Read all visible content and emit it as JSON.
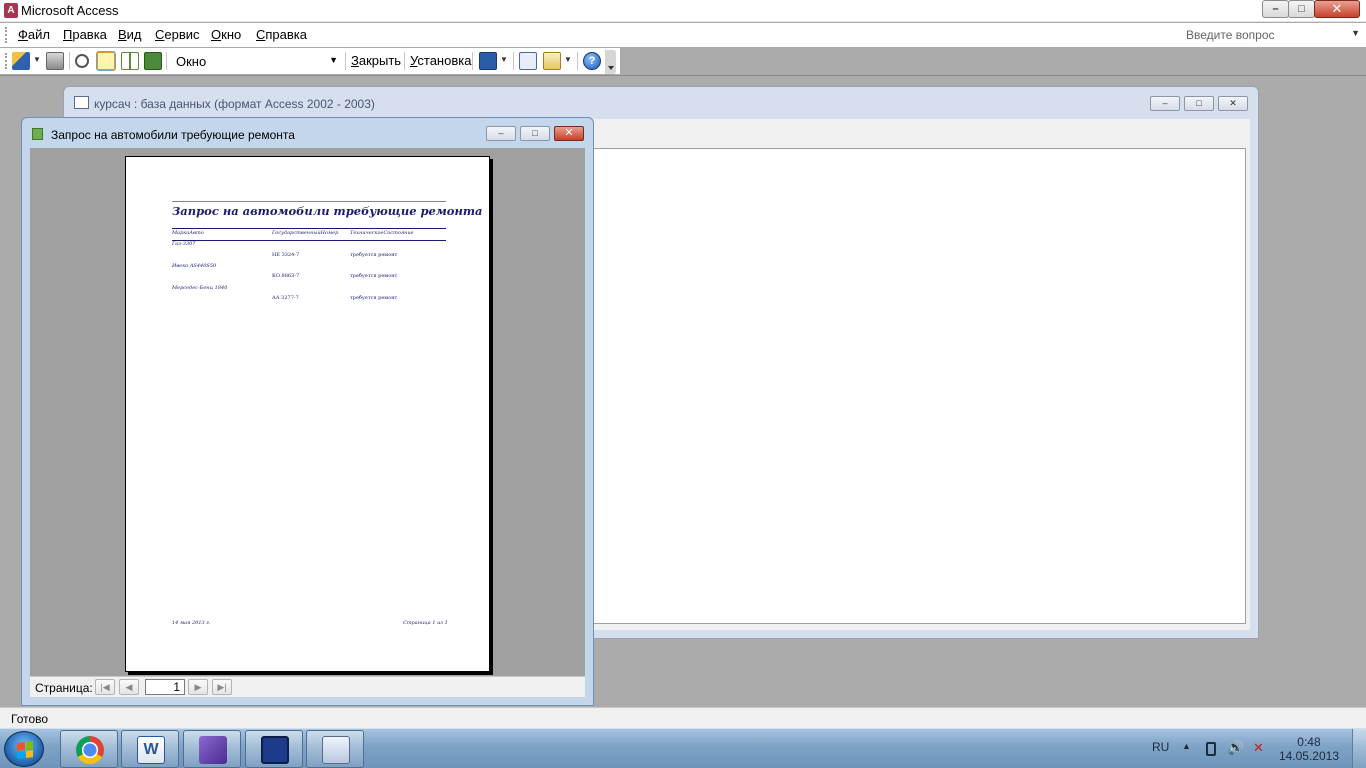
{
  "app": {
    "title": "Microsoft Access",
    "icon": "access-icon",
    "window_buttons": {
      "minimize": "–",
      "maximize": "□",
      "close": "✕"
    }
  },
  "menu": {
    "items": [
      "Файл",
      "Правка",
      "Вид",
      "Сервис",
      "Окно",
      "Справка"
    ],
    "help_placeholder": "Введите вопрос"
  },
  "toolbar": {
    "view_combo_value": "Окно",
    "close_label": "Закрыть",
    "setup_label": "Установка",
    "icons": [
      "design-view-icon",
      "print-icon",
      "zoom-icon",
      "one-page-icon",
      "two-pages-icon",
      "multiple-pages-icon",
      "office-links-icon",
      "database-window-icon",
      "new-object-icon",
      "help-icon"
    ]
  },
  "db_window": {
    "title": "курсач : база данных (формат Access 2002 - 2003)"
  },
  "report_window": {
    "title": "Запрос на автомобили требующие ремонта",
    "page_label": "Страница:",
    "page_number": "1"
  },
  "report": {
    "title": "Запрос на автомобили требующие ремонта",
    "columns": [
      "МаркаАвто",
      "ГосударственныйНомер",
      "ТехническоеСостояние"
    ],
    "rows": [
      {
        "make": "Газ-3307",
        "plate": "НЕ 3324-7",
        "state": "требуется ремонт"
      },
      {
        "make": "Ивеко AS440S50",
        "plate": "КО 8863-7",
        "state": "требуется ремонт"
      },
      {
        "make": "Мерседес-Бенц 1840",
        "plate": "АА 3277-7",
        "state": "требуется ремонт"
      }
    ],
    "footer_date": "14 мая 2013 г.",
    "footer_page": "Страница 1 из 1"
  },
  "statusbar": {
    "text": "Готово"
  },
  "taskbar": {
    "apps": [
      "chrome-icon",
      "word-icon",
      "visual-studio-icon",
      "access-save-icon",
      "windows-explorer-icon"
    ],
    "language": "RU",
    "time": "0:48",
    "date": "14.05.2013"
  },
  "colors": {
    "report_text": "#1a1a6e",
    "mdi_background": "#ababab",
    "window_frame": "#c4d6ec"
  }
}
